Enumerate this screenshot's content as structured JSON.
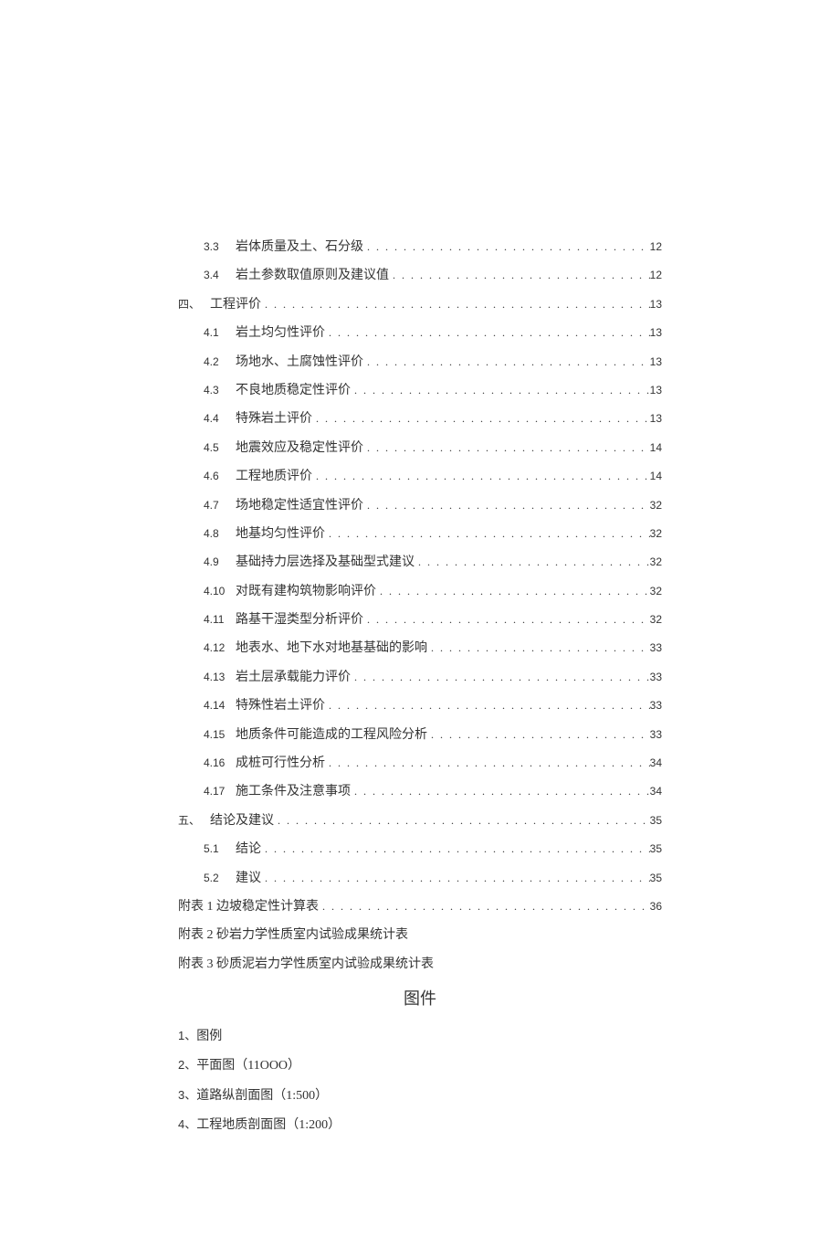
{
  "toc": [
    {
      "level": 2,
      "num": "3.3",
      "text": "岩体质量及土、石分级",
      "page": "12"
    },
    {
      "level": 2,
      "num": "3.4",
      "text": "岩土参数取值原则及建议值",
      "page": "12"
    },
    {
      "level": 1,
      "num": "四、",
      "text": "工程评价",
      "page": "13"
    },
    {
      "level": 2,
      "num": "4.1",
      "text": "岩土均匀性评价",
      "page": "13"
    },
    {
      "level": 2,
      "num": "4.2",
      "text": "场地水、土腐蚀性评价",
      "page": "13"
    },
    {
      "level": 2,
      "num": "4.3",
      "text": "不良地质稳定性评价",
      "page": "13"
    },
    {
      "level": 2,
      "num": "4.4",
      "text": "特殊岩土评价",
      "page": "13"
    },
    {
      "level": 2,
      "num": "4.5",
      "text": "地震效应及稳定性评价",
      "page": "14"
    },
    {
      "level": 2,
      "num": "4.6",
      "text": "工程地质评价",
      "page": "14"
    },
    {
      "level": 2,
      "num": "4.7",
      "text": "场地稳定性适宜性评价",
      "page": "32"
    },
    {
      "level": 2,
      "num": "4.8",
      "text": "地基均匀性评价",
      "page": "32"
    },
    {
      "level": 2,
      "num": "4.9",
      "text": "基础持力层选择及基础型式建议",
      "page": "32"
    },
    {
      "level": 2,
      "num": "4.10",
      "text": "对既有建构筑物影响评价",
      "page": "32"
    },
    {
      "level": 2,
      "num": "4.11",
      "text": "路基干湿类型分析评价",
      "page": "32"
    },
    {
      "level": 2,
      "num": "4.12",
      "text": "地表水、地下水对地基基础的影响",
      "page": "33"
    },
    {
      "level": 2,
      "num": "4.13",
      "text": "岩土层承载能力评价",
      "page": "33"
    },
    {
      "level": 2,
      "num": "4.14",
      "text": "特殊性岩土评价",
      "page": "33"
    },
    {
      "level": 2,
      "num": "4.15",
      "text": "地质条件可能造成的工程风险分析",
      "page": "33"
    },
    {
      "level": 2,
      "num": "4.16",
      "text": "成桩可行性分析",
      "page": "34"
    },
    {
      "level": 2,
      "num": "4.17",
      "text": "施工条件及注意事项",
      "page": "34"
    },
    {
      "level": 1,
      "num": "五、",
      "text": "结论及建议",
      "page": "35"
    },
    {
      "level": 2,
      "num": "5.1",
      "text": "结论",
      "page": "35"
    },
    {
      "level": 2,
      "num": "5.2",
      "text": "建议",
      "page": "35"
    },
    {
      "level": 1,
      "num": "",
      "text": "附表 1 边坡稳定性计算表",
      "page": "36"
    },
    {
      "level": 1,
      "num": "",
      "text": "附表 2 砂岩力学性质室内试验成果统计表",
      "page": ""
    },
    {
      "level": 1,
      "num": "",
      "text": "附表 3 砂质泥岩力学性质室内试验成果统计表",
      "page": ""
    }
  ],
  "figures_title": "图件",
  "figures": [
    {
      "num": "1、",
      "text": "图例"
    },
    {
      "num": "2、",
      "text": "平面图（11OOO）"
    },
    {
      "num": "3、",
      "text": "道路纵剖面图（1:500）"
    },
    {
      "num": "4、",
      "text": "工程地质剖面图（1:200）"
    }
  ]
}
